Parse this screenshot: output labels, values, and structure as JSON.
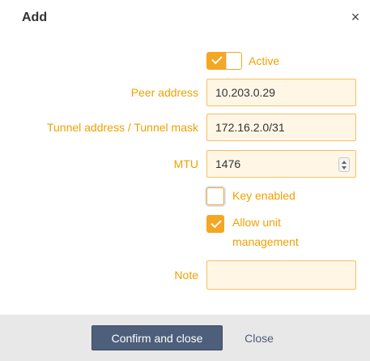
{
  "dialog": {
    "title": "Add",
    "close_glyph": "×"
  },
  "form": {
    "active": {
      "label": "Active",
      "checked": true
    },
    "peer_address": {
      "label": "Peer address",
      "value": "10.203.0.29"
    },
    "tunnel_address": {
      "label": "Tunnel address / Tunnel mask",
      "value": "172.16.2.0/31"
    },
    "mtu": {
      "label": "MTU",
      "value": "1476"
    },
    "key_enabled": {
      "label": "Key enabled",
      "checked": false
    },
    "allow_unit_management": {
      "label_line1": "Allow unit",
      "label_line2": "management",
      "checked": true
    },
    "note": {
      "label": "Note",
      "value": ""
    }
  },
  "footer": {
    "confirm_label": "Confirm and close",
    "close_label": "Close"
  },
  "colors": {
    "accent": "#f5a623",
    "label": "#f0a000",
    "input_bg": "#fff6e6",
    "primary_button": "#4d5f7a",
    "footer_bg": "#e8e8e8"
  },
  "icons": {
    "close": "close-icon",
    "check": "check-icon",
    "spinner": "spinner-icon"
  }
}
